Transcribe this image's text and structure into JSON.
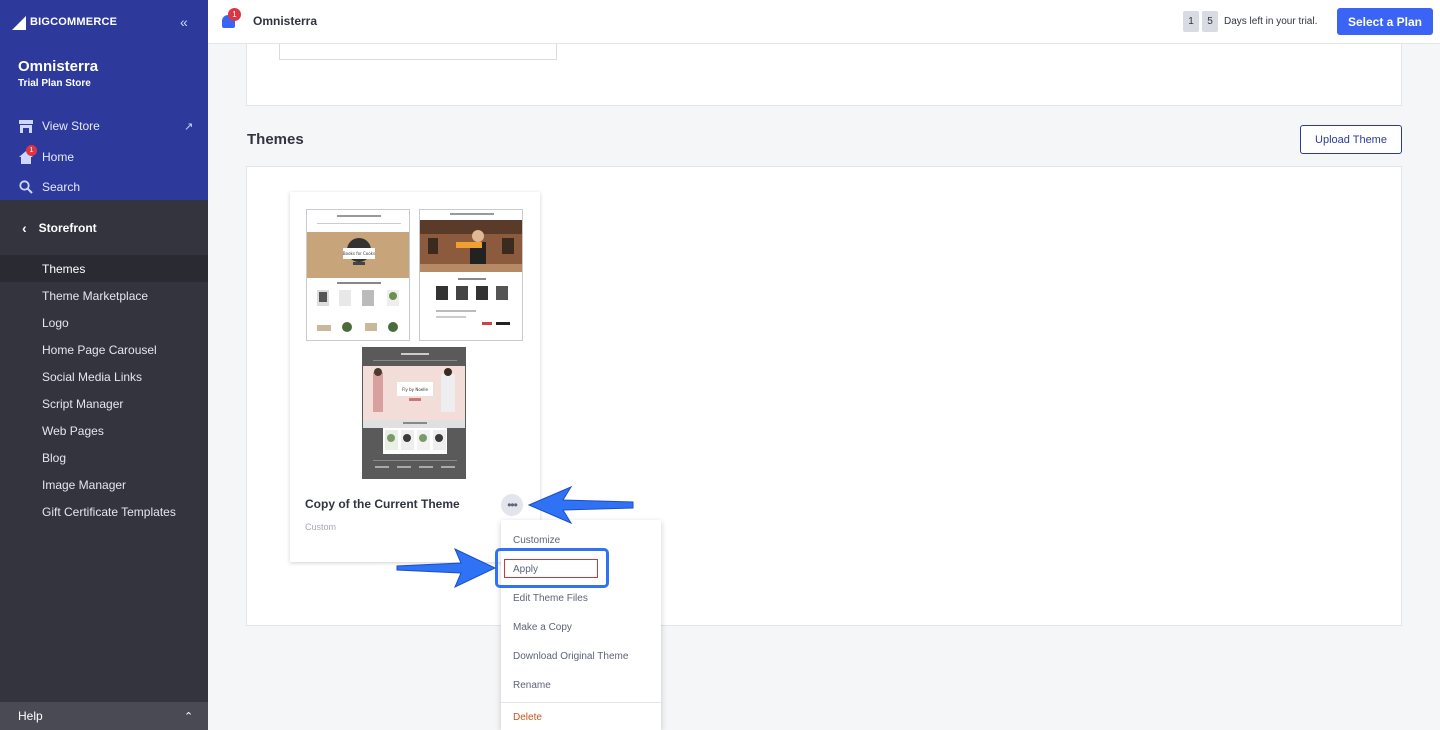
{
  "brand": {
    "logo_big": "BIG",
    "logo_rest": "COMMERCE"
  },
  "sidebar": {
    "store_name": "Omnisterra",
    "store_plan": "Trial Plan Store",
    "links": [
      {
        "label": "View Store",
        "icon": "storefront-icon"
      },
      {
        "label": "Home",
        "icon": "home-icon",
        "badge": "1"
      },
      {
        "label": "Search",
        "icon": "search-icon"
      }
    ],
    "section": "Storefront",
    "items": [
      {
        "label": "Themes",
        "active": true
      },
      {
        "label": "Theme Marketplace"
      },
      {
        "label": "Logo"
      },
      {
        "label": "Home Page Carousel"
      },
      {
        "label": "Social Media Links"
      },
      {
        "label": "Script Manager"
      },
      {
        "label": "Web Pages"
      },
      {
        "label": "Blog"
      },
      {
        "label": "Image Manager"
      },
      {
        "label": "Gift Certificate Templates"
      }
    ],
    "help": "Help"
  },
  "topbar": {
    "notification_count": "1",
    "store_name": "Omnisterra",
    "trial_digits": [
      "1",
      "5"
    ],
    "trial_text": "Days left in your trial.",
    "select_plan": "Select a Plan"
  },
  "main": {
    "themes_title": "Themes",
    "upload_button": "Upload Theme",
    "theme": {
      "name": "Copy of the Current Theme",
      "type": "Custom",
      "thumb1_banner": "Books for Cooks",
      "thumb3_banner": "Fly by Noelle"
    },
    "menu": [
      "Customize",
      "Apply",
      "Edit Theme Files",
      "Make a Copy",
      "Download Original Theme",
      "Rename",
      "Delete"
    ]
  },
  "colors": {
    "sidebar_top": "#2d3a9c",
    "sidebar": "#34343f",
    "accent": "#3c64f4",
    "annotation": "#2f72f5",
    "danger": "#c4551b"
  }
}
